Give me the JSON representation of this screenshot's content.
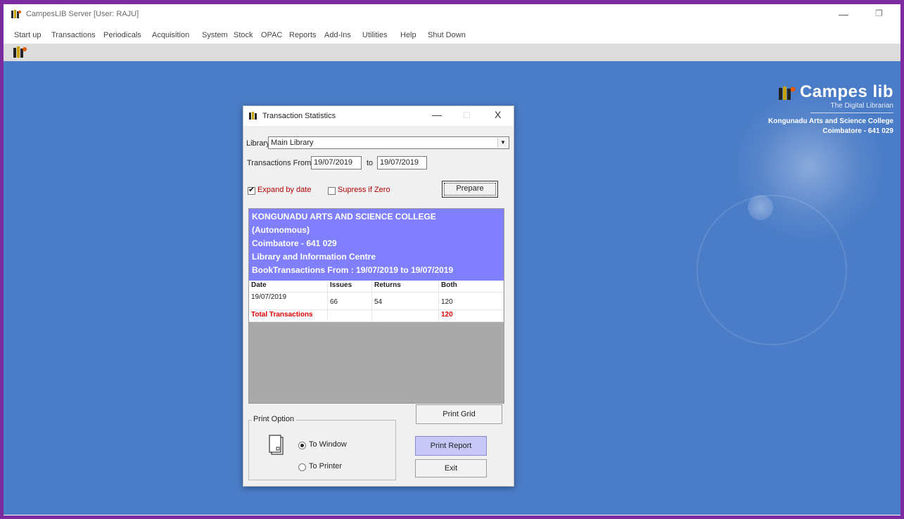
{
  "window": {
    "title": "CampesLIB Server [User: RAJU]",
    "min_glyph": "—",
    "max_glyph": "❐"
  },
  "menu": [
    "Start up",
    "Transactions",
    "Periodicals",
    "Acquisition",
    "System",
    "Stock",
    "OPAC",
    "Reports",
    "Add-Ins",
    "Utilities",
    "Help",
    "Shut Down"
  ],
  "branding": {
    "name": "Campes lib",
    "tagline": "The Digital Librarian",
    "college": "Kongunadu Arts and Science College",
    "city": "Coimbatore - 641 029"
  },
  "dialog": {
    "title": "Transaction Statistics",
    "min_glyph": "—",
    "max_glyph": "□",
    "close_glyph": "X",
    "library_label": "Library",
    "library_value": "Main Library",
    "from_label": "Transactions From",
    "from_value": "19/07/2019",
    "to_label": "to",
    "to_value": "19/07/2019",
    "expand_label": "Expand by date",
    "expand_checked": true,
    "suppress_label": "Supress if Zero",
    "suppress_checked": false,
    "prepare_label": "Prepare",
    "report_header": [
      "KONGUNADU ARTS AND SCIENCE COLLEGE",
      "(Autonomous)",
      "Coimbatore - 641 029",
      "Library and Information Centre",
      "BookTransactions From  : 19/07/2019 to 19/07/2019"
    ],
    "columns": [
      "Date",
      "Issues",
      "Returns",
      "Both"
    ],
    "rows": [
      [
        "19/07/2019",
        "66",
        "54",
        "120"
      ]
    ],
    "total_label": "Total Transactions",
    "total_value": "120",
    "print_grid_label": "Print Grid",
    "print_option_label": "Print Option",
    "to_window_label": "To Window",
    "to_printer_label": "To Printer",
    "print_option_selected": "To Window",
    "print_report_label": "Print Report",
    "exit_label": "Exit"
  }
}
